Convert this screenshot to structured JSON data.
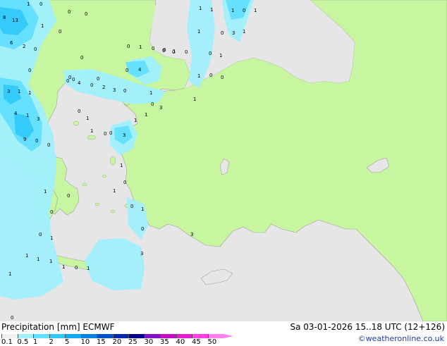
{
  "header": {
    "product": "Precipitation [mm]",
    "model": "ECMWF",
    "valid_time": "Sa 03-01-2026 15..18 UTC (12+126)"
  },
  "credit": "©weatheronline.co.uk",
  "legend": {
    "values": [
      "0.1",
      "0.5",
      "1",
      "2",
      "5",
      "10",
      "15",
      "20",
      "25",
      "30",
      "35",
      "40",
      "45",
      "50"
    ],
    "colors": [
      "#f0f0f0",
      "#a0f0ff",
      "#60e0ff",
      "#30c8f8",
      "#10a8f0",
      "#0880e0",
      "#0050c8",
      "#0028a8",
      "#000088",
      "#8010c0",
      "#c010c0",
      "#e020d0",
      "#ff40e0",
      "#ff80f0"
    ]
  },
  "colors": {
    "land": "#c8f5a0",
    "sea": "#e6e6e6",
    "rain_light": "#a0f0ff",
    "rain_mid": "#60e0ff",
    "rain_heavy": "#30c8f8"
  },
  "map_labels": [
    {
      "v": "1"
    },
    {
      "v": "0"
    },
    {
      "v": "0"
    },
    {
      "v": "13"
    },
    {
      "v": "8"
    },
    {
      "v": "1"
    },
    {
      "v": "0"
    },
    {
      "v": "6"
    },
    {
      "v": "2"
    },
    {
      "v": "0"
    },
    {
      "v": "0"
    },
    {
      "v": "0"
    },
    {
      "v": "0"
    },
    {
      "v": "0"
    },
    {
      "v": "0"
    },
    {
      "v": "1"
    },
    {
      "v": "3"
    },
    {
      "v": "1"
    },
    {
      "v": "1"
    },
    {
      "v": "4"
    },
    {
      "v": "1"
    },
    {
      "v": "3"
    },
    {
      "v": "9"
    },
    {
      "v": "0"
    },
    {
      "v": "0"
    },
    {
      "v": "4"
    },
    {
      "v": "0"
    },
    {
      "v": "2"
    },
    {
      "v": "3"
    },
    {
      "v": "0"
    },
    {
      "v": "0"
    },
    {
      "v": "4"
    },
    {
      "v": "0"
    },
    {
      "v": "1"
    },
    {
      "v": "0"
    },
    {
      "v": "0"
    },
    {
      "v": "3"
    },
    {
      "v": "0"
    },
    {
      "v": "0"
    },
    {
      "v": "0"
    },
    {
      "v": "0"
    },
    {
      "v": "1"
    },
    {
      "v": "1"
    },
    {
      "v": "1"
    },
    {
      "v": "0"
    },
    {
      "v": "1"
    },
    {
      "v": "1"
    },
    {
      "v": "0"
    },
    {
      "v": "3"
    },
    {
      "v": "1"
    },
    {
      "v": "0"
    },
    {
      "v": "1"
    },
    {
      "v": "1"
    },
    {
      "v": "0"
    },
    {
      "v": "0"
    },
    {
      "v": "0"
    },
    {
      "v": "0"
    },
    {
      "v": "0"
    },
    {
      "v": "1"
    },
    {
      "v": "1"
    },
    {
      "v": "1"
    },
    {
      "v": "0"
    },
    {
      "v": "0"
    },
    {
      "v": "1"
    },
    {
      "v": "1"
    },
    {
      "v": "1"
    },
    {
      "v": "1"
    },
    {
      "v": "1"
    },
    {
      "v": "0"
    },
    {
      "v": "1"
    },
    {
      "v": "1"
    },
    {
      "v": "0"
    },
    {
      "v": "1"
    },
    {
      "v": "0"
    },
    {
      "v": "0"
    },
    {
      "v": "3"
    },
    {
      "v": "3"
    },
    {
      "v": "0"
    },
    {
      "v": "1"
    },
    {
      "v": "0"
    },
    {
      "v": "1"
    },
    {
      "v": "1"
    },
    {
      "v": "1"
    },
    {
      "v": "0"
    },
    {
      "v": "1"
    },
    {
      "v": "1"
    },
    {
      "v": "0"
    },
    {
      "v": "3"
    }
  ]
}
